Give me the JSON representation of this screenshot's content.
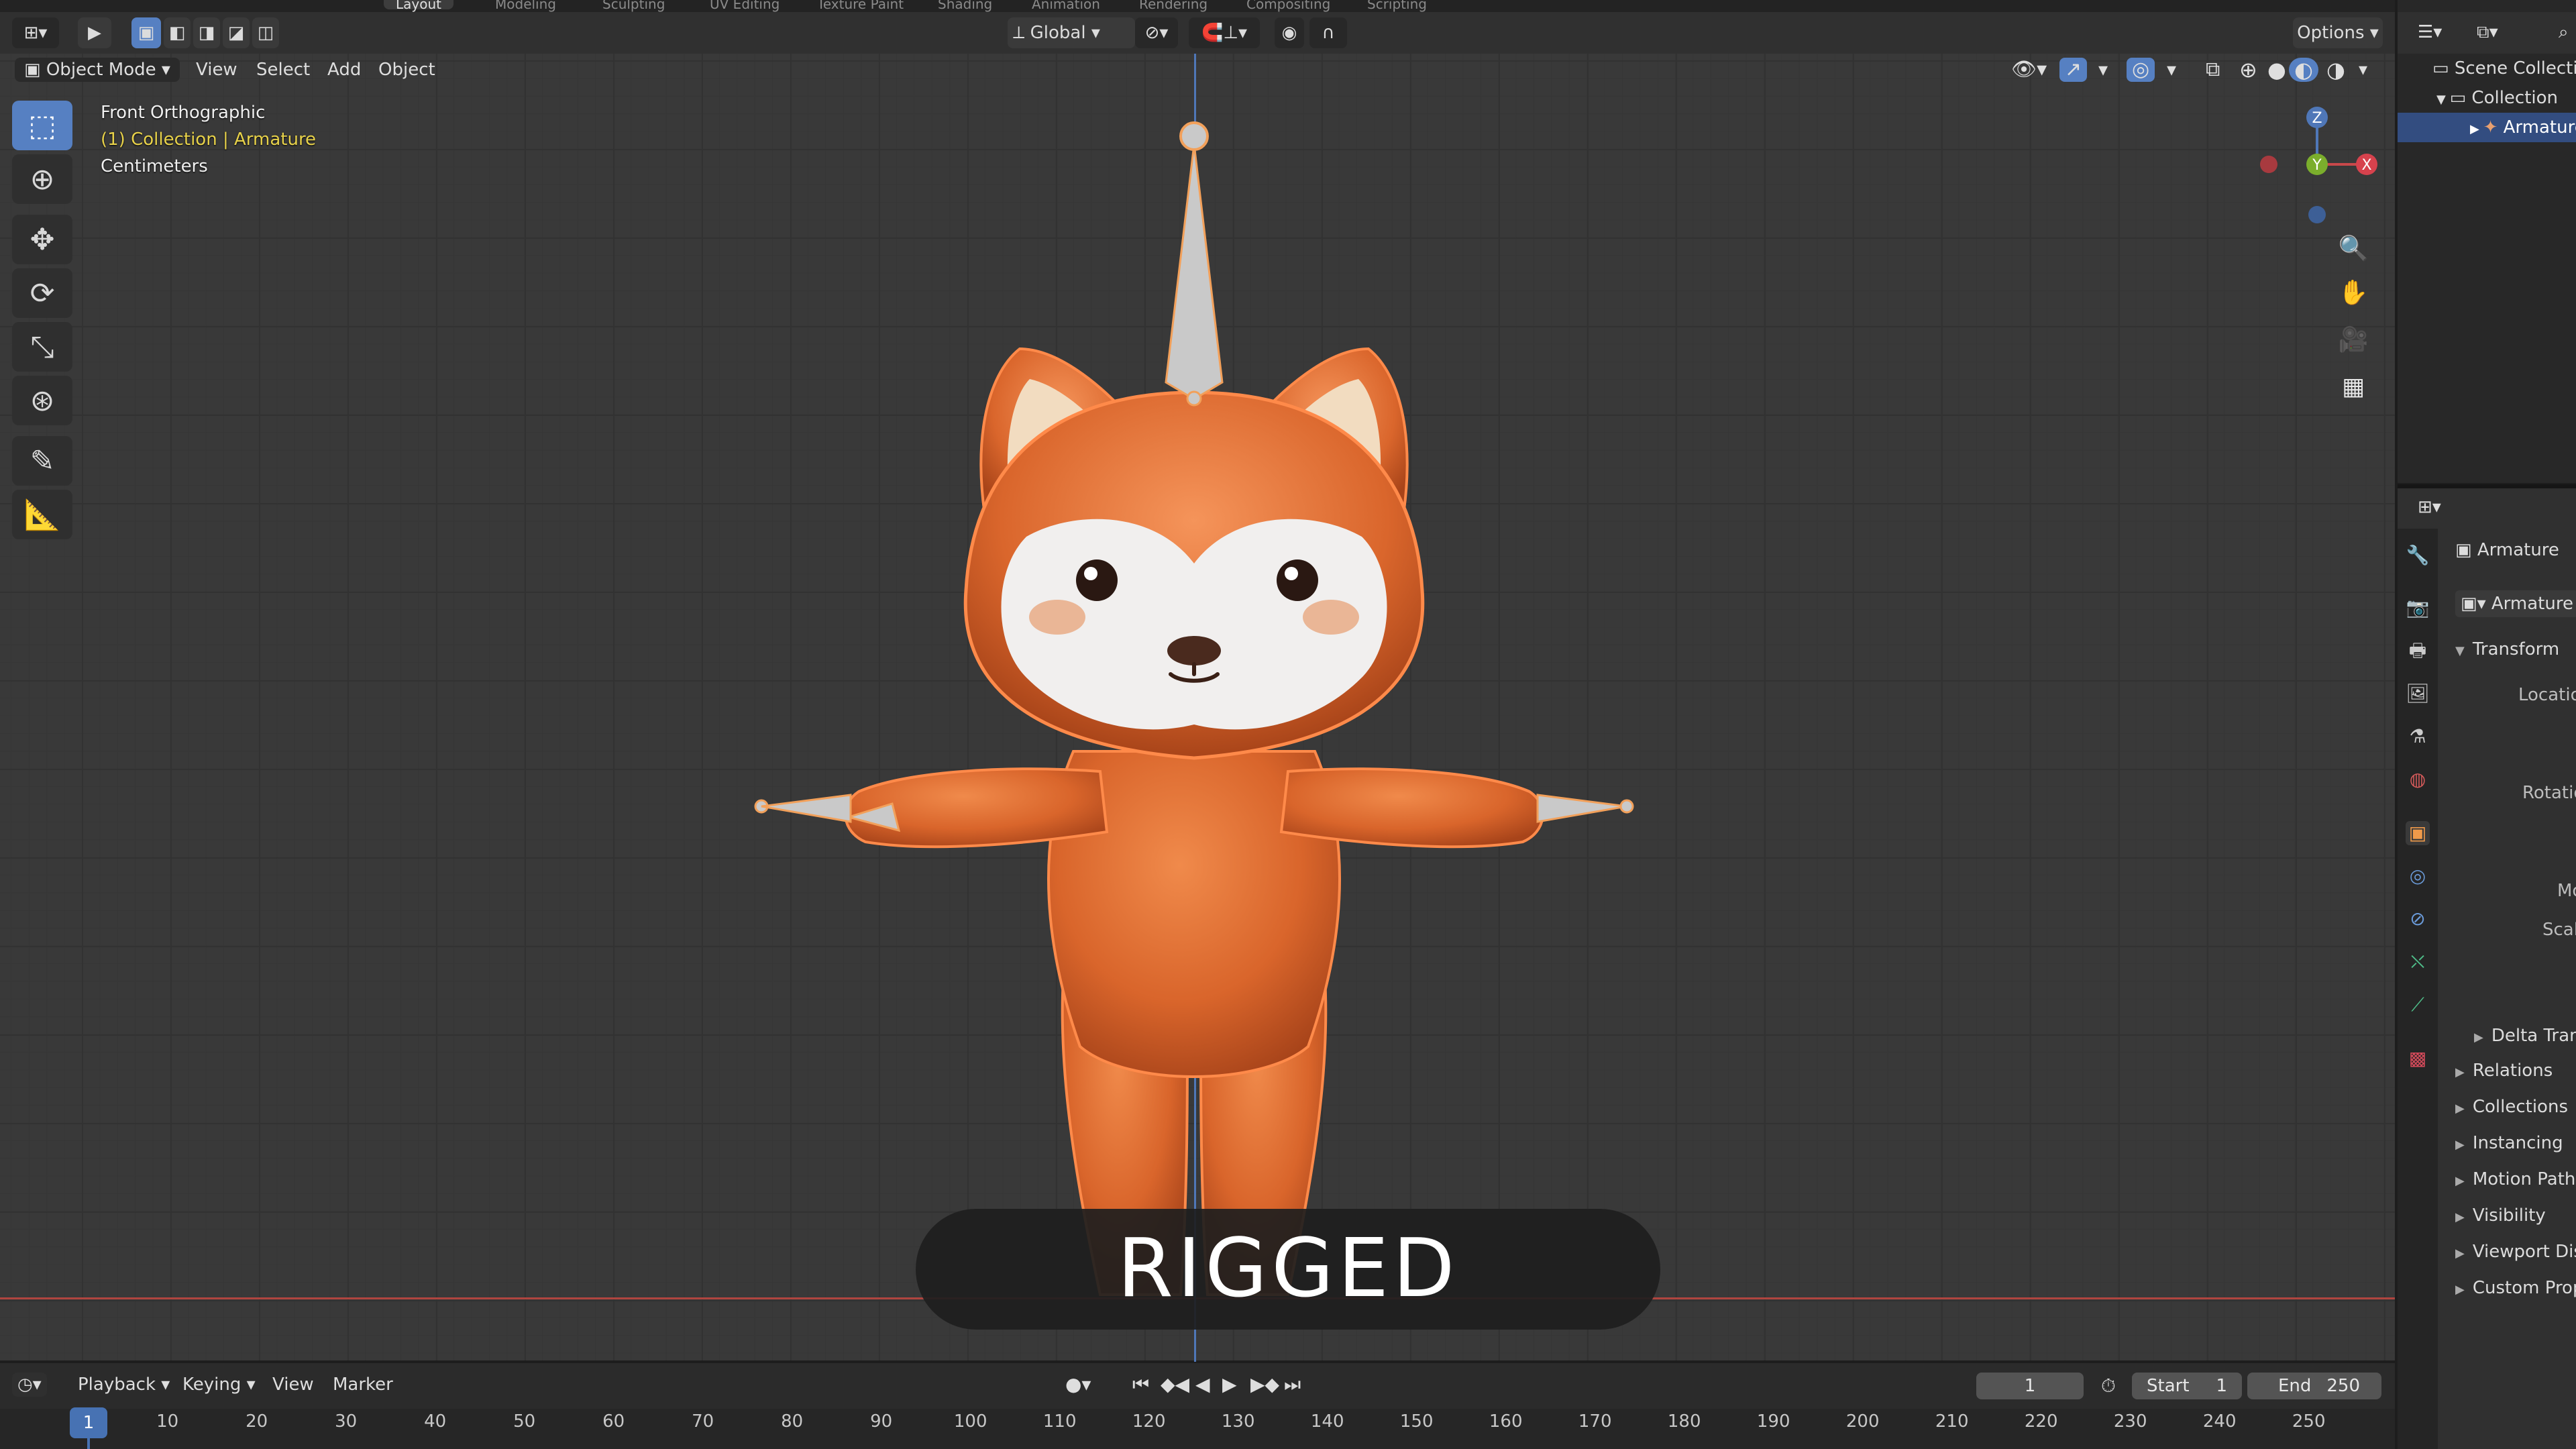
{
  "workspace_tabs": [
    "Layout",
    "Modeling",
    "Sculpting",
    "UV Editing",
    "Texture Paint",
    "Shading",
    "Animation",
    "Rendering",
    "Compositing",
    "Scripting"
  ],
  "header": {
    "transform_orientation": "Global",
    "options_label": "Options"
  },
  "viewport_menu": {
    "mode": "Object Mode",
    "items": [
      "View",
      "Select",
      "Add",
      "Object"
    ]
  },
  "viewport_info": {
    "view_name": "Front Orthographic",
    "collection_line": "(1) Collection | Armature",
    "units": "Centimeters"
  },
  "gizmo": {
    "z": "Z",
    "y": "Y",
    "x": "X"
  },
  "caption": "RIGGED",
  "timeline": {
    "menus": [
      "Playback",
      "Keying",
      "View",
      "Marker"
    ],
    "current_frame": "1",
    "start_label": "Start",
    "start_value": "1",
    "end_label": "End",
    "end_value": "250",
    "marker_frame": "1",
    "ticks": [
      "10",
      "20",
      "30",
      "40",
      "50",
      "60",
      "70",
      "80",
      "90",
      "100",
      "110",
      "120",
      "130",
      "140",
      "150",
      "160",
      "170",
      "180",
      "190",
      "200",
      "210",
      "220",
      "230",
      "240",
      "250"
    ]
  },
  "outliner": {
    "scene_collection": "Scene Collection",
    "collection": "Collection",
    "armature": "Armature"
  },
  "properties": {
    "object_name": "Armature",
    "datablock_name": "Armature",
    "transform": "Transform",
    "location": "Location",
    "rotation": "Rotation",
    "mode_cut": "Mo",
    "scale_cut": "Scale",
    "delta_transform": "Delta Transform",
    "panels": [
      "Relations",
      "Collections",
      "Instancing",
      "Motion Paths",
      "Visibility",
      "Viewport Display",
      "Custom Properties"
    ]
  },
  "colors": {
    "accent_blue": "#5680c2",
    "fox_orange": "#d9652b",
    "axis_red": "#b0453f",
    "axis_blue": "#4f77b8"
  }
}
